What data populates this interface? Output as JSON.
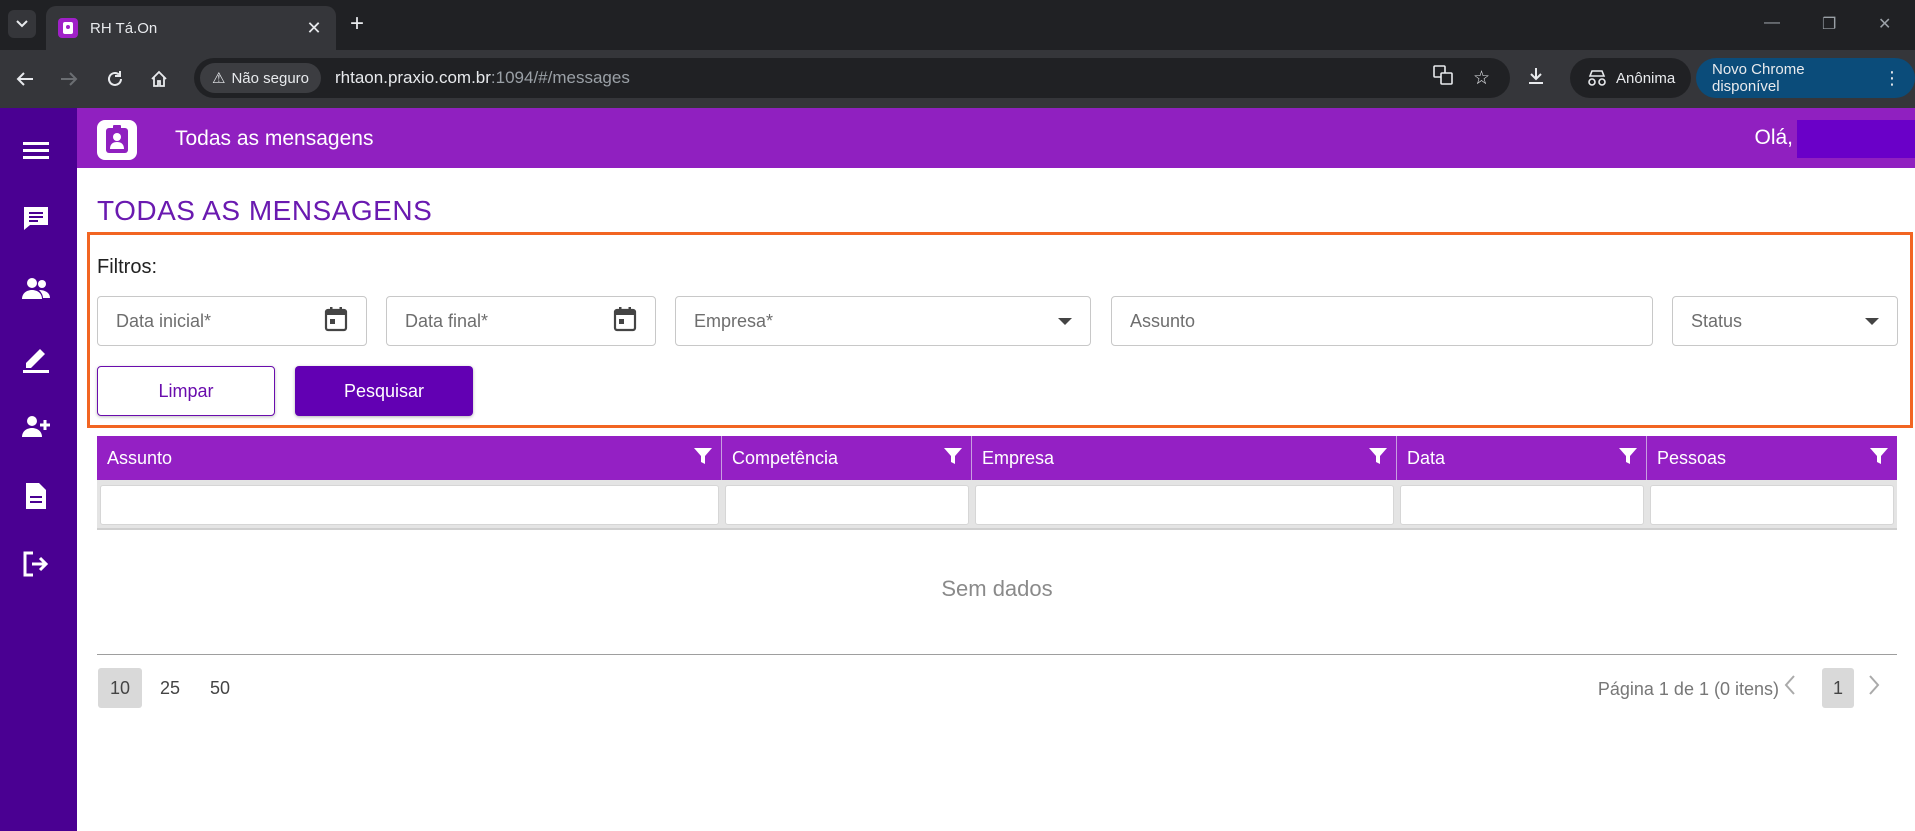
{
  "browser": {
    "tab_title": "RH Tá.On",
    "security_label": "Não seguro",
    "url_host": "rhtaon.praxio.com.br",
    "url_path": ":1094/#/messages",
    "incognito_label": "Anônima",
    "update_label": "Novo Chrome disponível"
  },
  "appbar": {
    "title": "Todas as mensagens",
    "greeting": "Olá,"
  },
  "page": {
    "heading": "TODAS AS MENSAGENS",
    "filters_label": "Filtros:",
    "fields": {
      "start_date": "Data inicial*",
      "end_date": "Data final*",
      "company": "Empresa*",
      "subject": "Assunto",
      "status": "Status"
    },
    "clear_label": "Limpar",
    "search_label": "Pesquisar"
  },
  "grid": {
    "columns": [
      "Assunto",
      "Competência",
      "Empresa",
      "Data",
      "Pessoas"
    ],
    "empty_text": "Sem dados"
  },
  "pager": {
    "sizes": [
      "10",
      "25",
      "50"
    ],
    "active_size": "10",
    "info": "Página 1 de 1 (0 itens)",
    "current_page": "1"
  },
  "colors": {
    "sidebar": "#4a0092",
    "appbar": "#9020c0",
    "accent": "#6200b3",
    "highlight": "#f26522"
  }
}
